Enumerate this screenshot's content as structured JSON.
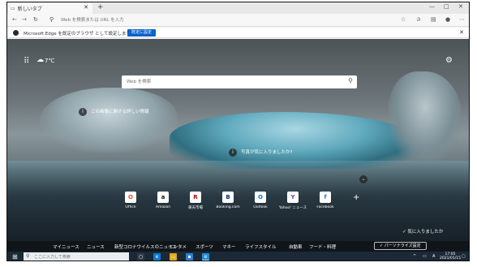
{
  "browser": {
    "tab_title": "新しいタブ",
    "new_tab": "+",
    "window_controls": [
      "—",
      "□",
      "✕"
    ],
    "address_placeholder": "Web を検索または URL を入力"
  },
  "infobar": {
    "message": "Microsoft Edge を既定のブラウザ として設定しますか?",
    "button": "既定に設定",
    "close": "✕"
  },
  "newtab": {
    "apps_icon": "app-launcher-icon",
    "weather": {
      "icon": "weather-icon",
      "temp": "7℃"
    },
    "settings_icon": "gear-icon",
    "search_placeholder": "Web を検索",
    "hotspots": [
      {
        "text": "この画像に関する詳しい情報",
        "icon": "info"
      },
      {
        "text": "写真が気に入りましたか?",
        "icon": "info"
      }
    ],
    "quick_links": [
      {
        "label": "Office",
        "color": "#e64a19",
        "glyph": "O"
      },
      {
        "label": "Amazon",
        "color": "#111111",
        "glyph": "a"
      },
      {
        "label": "楽天市場",
        "color": "#bf0000",
        "glyph": "R"
      },
      {
        "label": "Booking.com",
        "color": "#003580",
        "glyph": "B"
      },
      {
        "label": "Outlook",
        "color": "#0078d4",
        "glyph": "O"
      },
      {
        "label": "Yahoo! ニュース",
        "color": "#6a3fb5",
        "glyph": "Y"
      },
      {
        "label": "Facebook",
        "color": "#1877f2",
        "glyph": "f"
      }
    ],
    "add_link": "+",
    "like_link": "✓ 気に入りましたか",
    "news_tabs": [
      "マイニュース",
      "ニュース",
      "新型コロナウイルスのニュース",
      "エンタメ",
      "スポーツ",
      "マネー",
      "ライフスタイル",
      "自動車",
      "フード・料理"
    ],
    "personalize": "✓ パーソナライズ設定"
  },
  "taskbar": {
    "search_placeholder": "ここに入力して検索",
    "apps": [
      {
        "name": "task-view",
        "color": "#2b3a48",
        "glyph": "○"
      },
      {
        "name": "edge",
        "color": "#0a7ad1",
        "glyph": "e"
      },
      {
        "name": "explorer",
        "color": "#e0a81c",
        "glyph": "▭"
      },
      {
        "name": "store",
        "color": "#2d7fd2",
        "glyph": "▪"
      },
      {
        "name": "edge-active",
        "color": "#1f8ed6",
        "glyph": "e"
      }
    ],
    "tray": {
      "ime": "A",
      "time": "17:05",
      "date": "2021/01/15"
    }
  },
  "colors": {
    "accent": "#0a63c9",
    "taskbar": "#1b2936"
  }
}
